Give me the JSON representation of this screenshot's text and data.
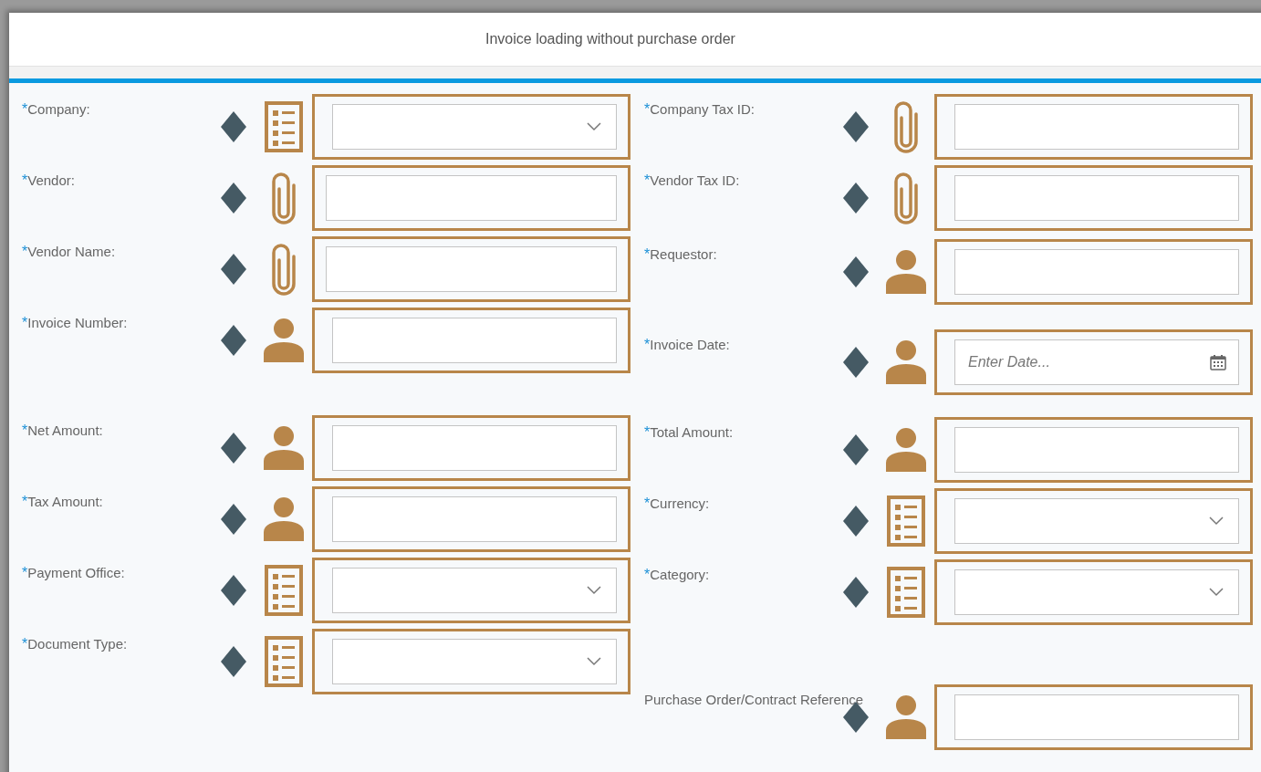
{
  "window": {
    "title": "Invoice loading without purchase order"
  },
  "columns": [
    {
      "fields": [
        {
          "mark": "*",
          "label": "Company:",
          "kind": "select",
          "icon": {
            "kind": "list"
          }
        },
        {
          "mark": "*",
          "label": "Vendor:",
          "kind": "text",
          "icon": {
            "kind": "clip"
          }
        },
        {
          "mark": "*",
          "label": "Vendor Name:",
          "kind": "text",
          "icon": {
            "kind": "clip"
          }
        },
        {
          "mark": "*",
          "label": "Invoice Number:",
          "kind": "text",
          "icon": {
            "kind": "person"
          }
        },
        {
          "mark": "*",
          "label": "Net Amount:",
          "kind": "text",
          "icon": {
            "kind": "person"
          }
        },
        {
          "mark": "*",
          "label": "Tax Amount:",
          "kind": "text",
          "icon": {
            "kind": "person"
          }
        },
        {
          "mark": "*",
          "label": "Payment Office:",
          "kind": "select",
          "icon": {
            "kind": "list"
          }
        },
        {
          "mark": "*",
          "label": "Document Type:",
          "kind": "select",
          "icon": {
            "kind": "list"
          }
        }
      ]
    },
    {
      "fields": [
        {
          "mark": "*",
          "label": "Company Tax ID:",
          "kind": "text",
          "icon": {
            "kind": "clip"
          }
        },
        {
          "mark": "*",
          "label": "Vendor Tax ID:",
          "kind": "text",
          "icon": {
            "kind": "clip"
          }
        },
        {
          "mark": "*",
          "label": "Requestor:",
          "kind": "text",
          "icon": {
            "kind": "person"
          }
        },
        {
          "mark": "*",
          "label": "Invoice Date:",
          "kind": "date",
          "icon": {
            "kind": "person"
          },
          "placeholder": "Enter Date..."
        },
        {
          "mark": "*",
          "label": "Total Amount:",
          "kind": "text",
          "icon": {
            "kind": "person"
          }
        },
        {
          "mark": "*",
          "label": "Currency:",
          "kind": "select",
          "icon": {
            "kind": "list"
          }
        },
        {
          "mark": "*",
          "label": "Category:",
          "kind": "select",
          "icon": {
            "kind": "list"
          }
        },
        {
          "label": "Purchase Order/Contract Reference",
          "kind": "text",
          "icon": {
            "kind": "person"
          }
        }
      ]
    }
  ]
}
